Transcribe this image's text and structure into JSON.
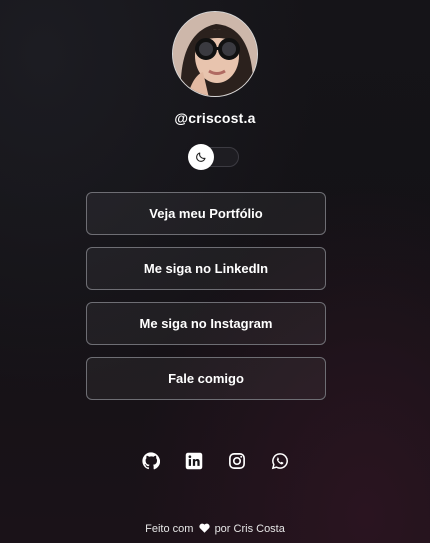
{
  "profile": {
    "handle": "@criscost.a"
  },
  "theme_toggle": {
    "icon": "moon-icon",
    "state": "on"
  },
  "links": [
    {
      "label": "Veja meu Portfólio"
    },
    {
      "label": "Me siga no LinkedIn"
    },
    {
      "label": "Me siga no Instagram"
    },
    {
      "label": "Fale comigo"
    }
  ],
  "socials": [
    "github-icon",
    "linkedin-icon",
    "instagram-icon",
    "whatsapp-icon"
  ],
  "footer": {
    "prefix": "Feito com",
    "suffix": "por Cris Costa"
  },
  "colors": {
    "background": "#151418",
    "button_border": "#6e6e74",
    "text": "#ffffff"
  }
}
